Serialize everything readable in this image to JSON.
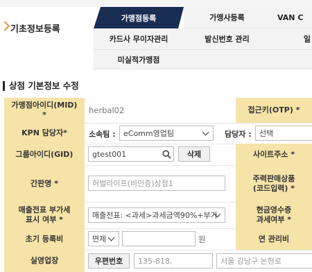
{
  "menu": {
    "title": "기초정보등록"
  },
  "tabs": {
    "row1": [
      "가맹점등록",
      "가맹사등록",
      "VAN C"
    ],
    "row2": [
      "카드사 무이자관리",
      "발신번호 관리",
      "일"
    ],
    "row3": [
      "미실적가맹점"
    ]
  },
  "section": {
    "title": "상점 기본정보 수정"
  },
  "form": {
    "mid": {
      "label": "가맹점아이디(MID)\n*",
      "value": "herbal02"
    },
    "otp": {
      "label": "접근키(OTP) *"
    },
    "kpn": {
      "label": "KPN 담당자*",
      "team_label": "소속팀 :",
      "team_value": "eComm영업팀",
      "manager_label": "담당자 :",
      "manager_value": "선택"
    },
    "gid": {
      "label": "그룹아이디(GID)",
      "value": "gtest001",
      "delete_label": "삭제"
    },
    "site": {
      "label": "사이트주소 *"
    },
    "name": {
      "label": "간판명 *",
      "value": "허벌라이프(비인증)상점1"
    },
    "product": {
      "label": "주력판매상품\n(코드입력) *"
    },
    "vat": {
      "label": "매출전표 부가세\n표시 여부 *",
      "value": "매출전표: <과세>과세금액90%+부가"
    },
    "cash": {
      "label": "현금영수증\n과세여부 *"
    },
    "fee": {
      "label": "초기 등록비",
      "select": "면제",
      "unit": "원"
    },
    "annual": {
      "label": "연 관리비"
    },
    "address": {
      "label": "실영업장",
      "postcode_button": "우편번호",
      "postcode": "135-818,",
      "address": "서울 강남구 논현로"
    }
  },
  "colors": {
    "tab_active": "#1a2d52",
    "label_bg": "#f6e3a8",
    "accent": "#e8892b"
  },
  "icons": {
    "menu_arrow": "chevron-right-icon",
    "search": "search-icon"
  }
}
